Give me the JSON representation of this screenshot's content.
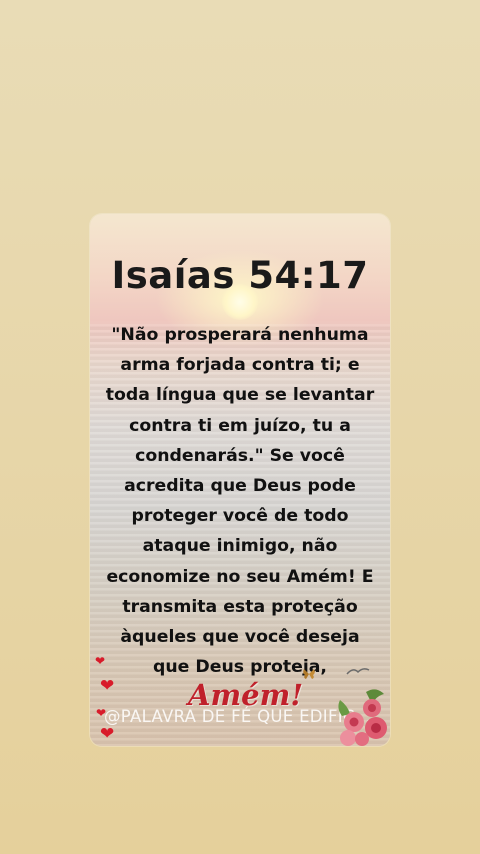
{
  "card": {
    "title": "Isaías 54:17",
    "verse": "\"Não prosperará nenhuma arma forjada contra ti; e toda língua que se levantar contra ti em juízo, tu a condenarás.\" Se você acredita que Deus pode proteger você de todo ataque inimigo, não economize no seu Amém! E transmita esta proteção àqueles que você deseja que Deus proteja,",
    "amen": "Amém!",
    "watermark": "@PALAVRA DE FÉ QUE EDIFIC..."
  },
  "icons": [
    "heart-icon",
    "rose-bouquet-icon",
    "bird-icon",
    "butterfly-icon"
  ],
  "colors": {
    "background": "#e7d6a9",
    "title": "#1a1a1a",
    "amen": "#c0212b",
    "heart": "#d81b2a"
  }
}
